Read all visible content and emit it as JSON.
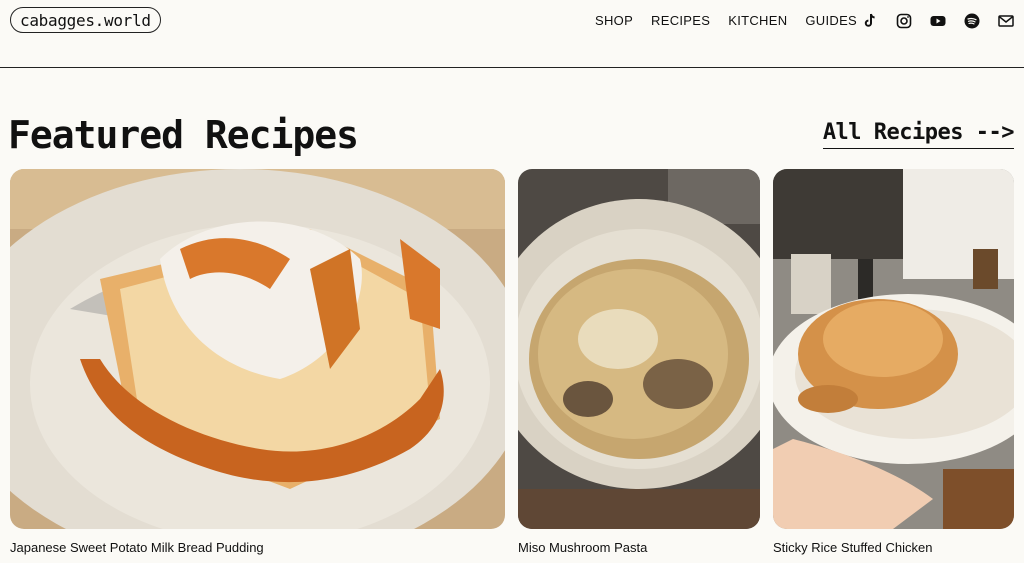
{
  "header": {
    "logo": "cabagges.world",
    "menu": [
      "SHOP",
      "RECIPES",
      "KITCHEN",
      "GUIDES"
    ],
    "socials": [
      "tiktok-icon",
      "instagram-icon",
      "youtube-icon",
      "spotify-icon",
      "mail-icon"
    ]
  },
  "main": {
    "heading": "Featured Recipes",
    "all_link": "All Recipes -->",
    "cards": [
      {
        "title": "Japanese  Sweet Potato Milk Bread  Pudding"
      },
      {
        "title": "Miso Mushroom Pasta"
      },
      {
        "title": "Sticky Rice Stuffed Chicken"
      }
    ]
  }
}
